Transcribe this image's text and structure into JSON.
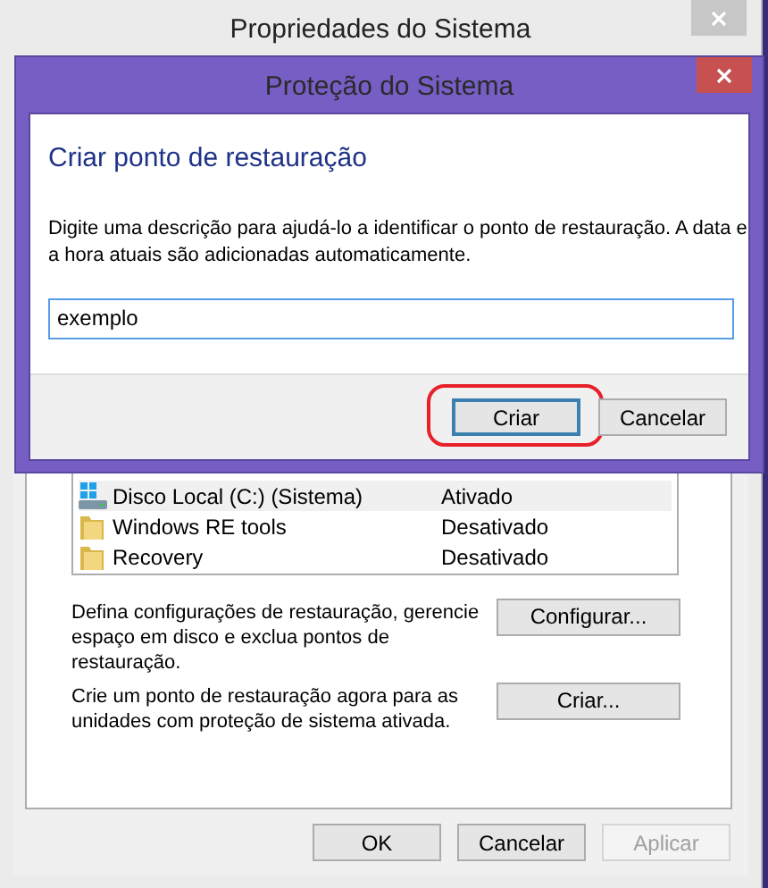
{
  "window": {
    "title": "Propriedades do Sistema"
  },
  "drives": [
    {
      "name": "Disco Local (C:) (Sistema)",
      "protection": "Ativado",
      "kind": "drive",
      "selected": true
    },
    {
      "name": "Windows RE tools",
      "protection": "Desativado",
      "kind": "folder",
      "selected": false
    },
    {
      "name": "Recovery",
      "protection": "Desativado",
      "kind": "folder",
      "selected": false
    }
  ],
  "actions": [
    {
      "description": "Defina configurações de restauração, gerencie espaço em disco e exclua pontos de restauração.",
      "button": "Configurar..."
    },
    {
      "description": "Crie um ponto de restauração agora para as unidades com proteção de sistema ativada.",
      "button": "Criar..."
    }
  ],
  "buttons": [
    {
      "label": "OK",
      "disabled": false
    },
    {
      "label": "Cancelar",
      "disabled": false
    },
    {
      "label": "Aplicar",
      "disabled": true
    }
  ],
  "dialog": {
    "title": "Proteção do Sistema",
    "heading": "Criar ponto de restauração",
    "description": "Digite uma descrição para ajudá-lo a identificar o ponto de restauração. A data e a hora atuais são adicionadas automaticamente.",
    "input": {
      "value": "exemplo"
    },
    "buttons": [
      {
        "label": "Criar",
        "default": true,
        "highlighted": true
      },
      {
        "label": "Cancelar",
        "default": false,
        "highlighted": false
      }
    ]
  }
}
